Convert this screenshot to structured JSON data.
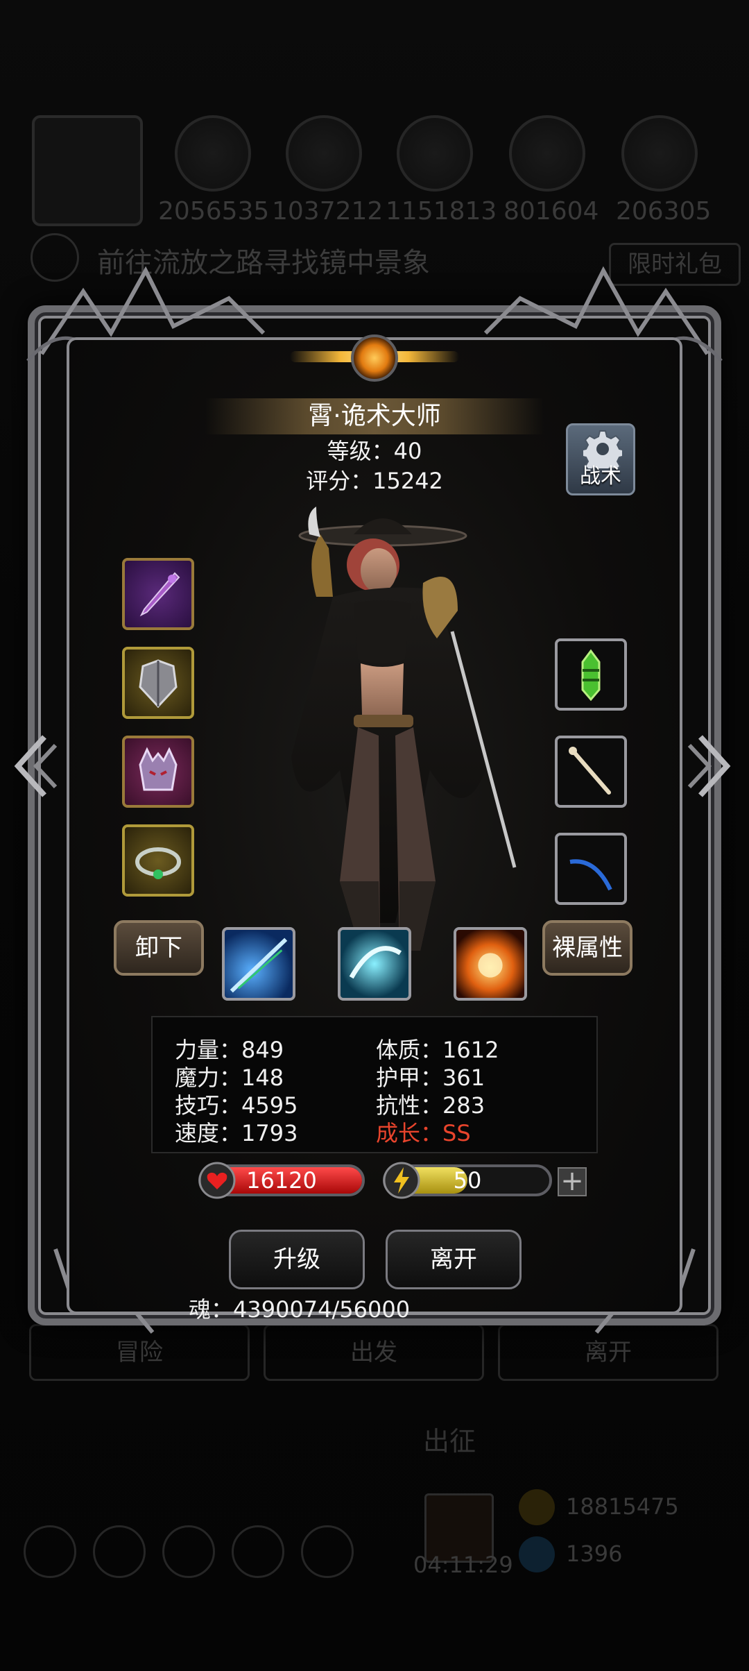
{
  "background": {
    "resources": [
      "2056535",
      "1037212",
      "1151813",
      "801604",
      "206305"
    ],
    "quest_text": "前往流放之路寻找镜中景象",
    "limited_gift": "限时礼包",
    "tabs": [
      "冒险",
      "出发",
      "离开"
    ],
    "expedition": "出征",
    "timer": "04:11:29",
    "gold": "18815475",
    "gems": "1396"
  },
  "hero": {
    "name": "霄·诡术大师",
    "level": "等级：40",
    "score": "评分：15242",
    "tactics_label": "战术"
  },
  "equipment": {
    "left_slots": [
      "dagger-icon",
      "chest-armor-icon",
      "demon-helmet-icon",
      "emerald-ring-icon"
    ],
    "right_slots": [
      "green-amulet-icon",
      "bone-wand-icon",
      "blue-bow-icon"
    ]
  },
  "buttons": {
    "unequip": "卸下",
    "base_attributes": "裸属性",
    "upgrade": "升级",
    "leave": "离开",
    "plus": "+"
  },
  "skills": [
    "blue-arrow-skill-icon",
    "cyan-slash-skill-icon",
    "fire-burst-skill-icon"
  ],
  "stats": {
    "strength": "力量：849",
    "magic": "魔力：148",
    "skill": "技巧：4595",
    "speed": "速度：1793",
    "constitution": "体质：1612",
    "armor": "护甲：361",
    "resistance": "抗性：283",
    "growth": "成长：SS"
  },
  "bars": {
    "hp": "16120",
    "energy": "50",
    "hp_fill": 1.0,
    "energy_fill": 0.5
  },
  "soul": "魂：4390074/56000",
  "colors": {
    "growth": "#e8442c",
    "hp": "#c81414",
    "energy": "#d8c020"
  }
}
